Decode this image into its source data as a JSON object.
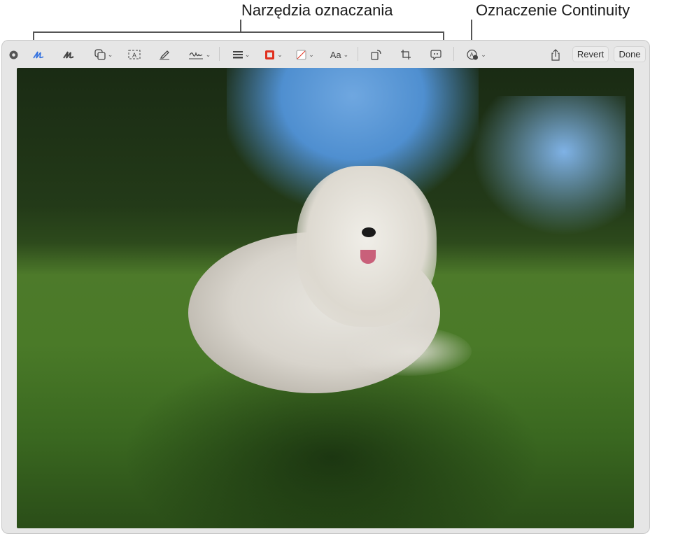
{
  "callouts": {
    "markup_tools": "Narzędzia oznaczania",
    "continuity": "Oznaczenie Continuity"
  },
  "toolbar": {
    "tools": [
      "record-icon",
      "sketch-icon",
      "draw-icon",
      "shapes-icon",
      "text-box-icon",
      "highlight-icon",
      "signature-icon",
      "line-style-icon",
      "border-color-icon",
      "fill-color-icon",
      "text-style-icon",
      "rotate-icon",
      "crop-icon",
      "description-icon",
      "continuity-markup-icon",
      "share-icon"
    ],
    "text_style_label": "Aa",
    "revert_label": "Revert",
    "done_label": "Done"
  },
  "colors": {
    "active_tool": "#2f6fe0",
    "border_color": "#e0301e"
  }
}
